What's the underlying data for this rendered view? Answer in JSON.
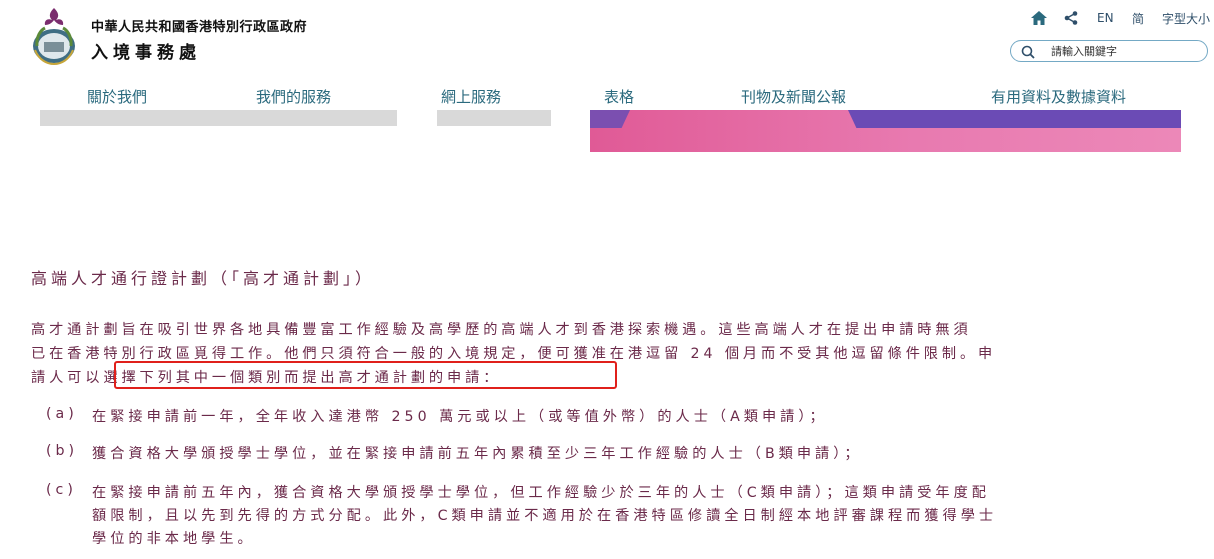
{
  "header": {
    "gov_name": "中華人民共和國香港特別行政區政府",
    "dept_name": "入境事務處",
    "util": {
      "lang_en": "EN",
      "lang_sc": "简",
      "font_size": "字型大小"
    },
    "search": {
      "placeholder": "請輸入關鍵字"
    }
  },
  "nav": {
    "items": [
      {
        "label": "關於我們"
      },
      {
        "label": "我們的服務"
      },
      {
        "label": "網上服務"
      },
      {
        "label": "表格"
      },
      {
        "label": "刊物及新聞公報"
      },
      {
        "label": "有用資料及數據資料"
      }
    ]
  },
  "content": {
    "title": "高端人才通行證計劃（「高才通計劃」）",
    "para": {
      "line1": "高才通計劃旨在吸引世界各地具備豐富工作經驗及高學歷的高端人才到香港探索機遇。這些高端人才在提出申請時無須",
      "line2": "已在香港特別行政區覓得工作。他們只須符合一般的入境規定，便可獲准在港逗留 24 個月而不受其他逗留條件限制。申",
      "line3a": "請人可以",
      "line3b": "選擇下列其中一個類別而提出高才通計劃的申請："
    },
    "list": {
      "a_marker": "(a)",
      "a_text": "在緊接申請前一年，全年收入達港幣 250 萬元或以上（或等值外幣）的人士（A類申請）；",
      "b_marker": "(b)",
      "b_text": "獲合資格大學頒授學士學位，並在緊接申請前五年內累積至少三年工作經驗的人士（B類申請）；",
      "c_marker": "(c)",
      "c_line1": "在緊接申請前五年內，獲合資格大學頒授學士學位，但工作經驗少於三年的人士（C類申請）；這類申請受年度配",
      "c_line2": "額限制，且以先到先得的方式分配。此外，C類申請並不適用於在香港特區修讀全日制經本地評審課程而獲得學士",
      "c_line3": "學位的非本地學生。"
    }
  },
  "colors": {
    "accent_text": "#6b2a4a",
    "nav_text": "#2b6a7e",
    "highlight": "#e0201b",
    "banner": "#e05a96"
  },
  "icons": [
    "emblem-icon",
    "home-icon",
    "share-icon",
    "search-icon"
  ]
}
